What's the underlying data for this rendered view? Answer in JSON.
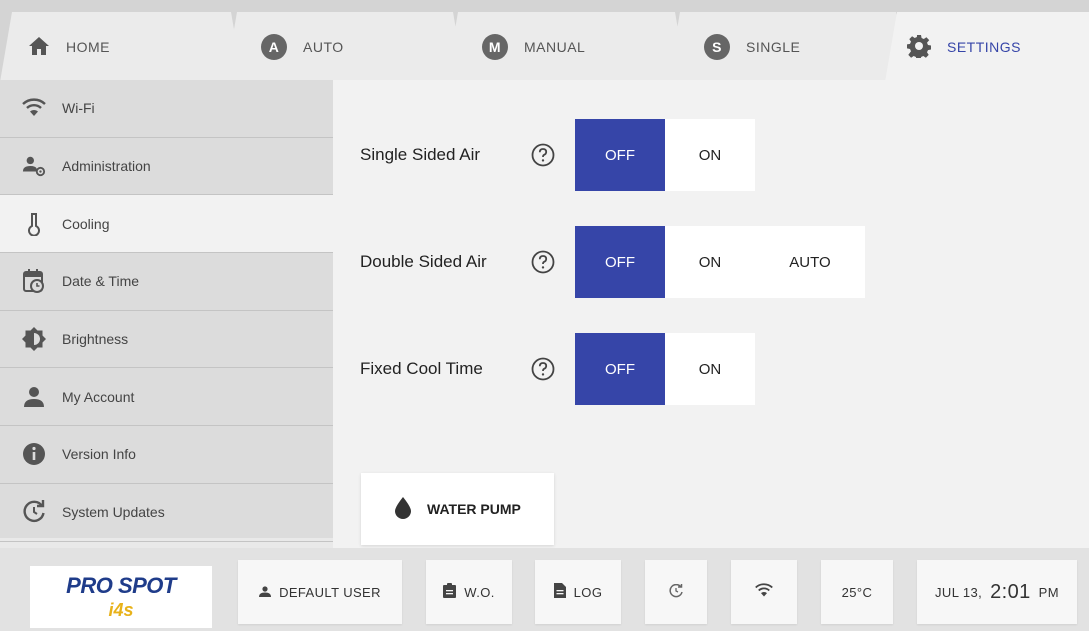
{
  "tabs": [
    {
      "label": "HOME",
      "icon": "home-icon"
    },
    {
      "label": "AUTO",
      "badge": "A"
    },
    {
      "label": "MANUAL",
      "badge": "M"
    },
    {
      "label": "SINGLE",
      "badge": "S"
    },
    {
      "label": "SETTINGS",
      "icon": "gear-icon",
      "active": true
    }
  ],
  "sidebar": {
    "items": [
      {
        "label": "Wi-Fi",
        "icon": "wifi-icon"
      },
      {
        "label": "Administration",
        "icon": "admin-user-gear-icon"
      },
      {
        "label": "Cooling",
        "icon": "thermometer-icon",
        "active": true
      },
      {
        "label": "Date & Time",
        "icon": "calendar-clock-icon"
      },
      {
        "label": "Brightness",
        "icon": "brightness-icon"
      },
      {
        "label": "My Account",
        "icon": "person-icon"
      },
      {
        "label": "Version Info",
        "icon": "info-icon"
      },
      {
        "label": "System Updates",
        "icon": "update-icon"
      }
    ]
  },
  "settings": {
    "single_sided_air": {
      "label": "Single Sided Air",
      "options": [
        "OFF",
        "ON"
      ],
      "selected": "OFF"
    },
    "double_sided_air": {
      "label": "Double Sided Air",
      "options": [
        "OFF",
        "ON",
        "AUTO"
      ],
      "selected": "OFF"
    },
    "fixed_cool_time": {
      "label": "Fixed Cool Time",
      "options": [
        "OFF",
        "ON"
      ],
      "selected": "OFF"
    }
  },
  "water_pump": {
    "label": "WATER PUMP",
    "icon": "water-drop-icon"
  },
  "bottom": {
    "logo_text": "PRO SPOT",
    "logo_sub": "i4s",
    "user": "DEFAULT USER",
    "wo": "W.O.",
    "log": "LOG",
    "temperature": "25°C",
    "date": "JUL 13,",
    "time": "2:01",
    "ampm": "PM"
  },
  "colors": {
    "accent": "#3645a8",
    "brand_blue": "#1f3c8a",
    "brand_yellow": "#e8b21a"
  }
}
